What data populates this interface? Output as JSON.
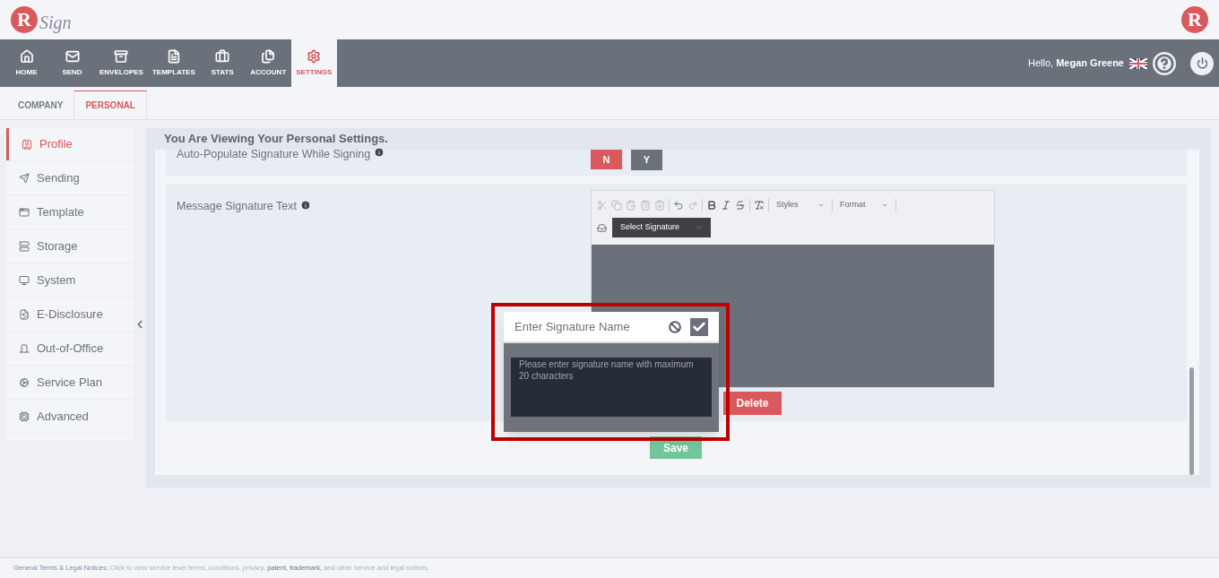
{
  "logo": {
    "letter": "R",
    "script": "Sign"
  },
  "corner_logo": {
    "letter": "R"
  },
  "nav": [
    {
      "label": "HOME",
      "selected": false
    },
    {
      "label": "SEND",
      "selected": false
    },
    {
      "label": "ENVELOPES",
      "selected": false
    },
    {
      "label": "TEMPLATES",
      "selected": false
    },
    {
      "label": "STATS",
      "selected": false
    },
    {
      "label": "ACCOUNT",
      "selected": false
    },
    {
      "label": "SETTINGS",
      "selected": true
    }
  ],
  "greeting": "Hello, **Megan Greene**",
  "subtabs": [
    {
      "label": "COMPANY",
      "selected": false
    },
    {
      "label": "PERSONAL",
      "selected": true
    }
  ],
  "sidebar": [
    {
      "label": "Profile",
      "selected": true
    },
    {
      "label": "Sending",
      "selected": false
    },
    {
      "label": "Template",
      "selected": false
    },
    {
      "label": "Storage",
      "selected": false
    },
    {
      "label": "System",
      "selected": false
    },
    {
      "label": "E-Disclosure",
      "selected": false
    },
    {
      "label": "Out-of-Office",
      "selected": false
    },
    {
      "label": "Service Plan",
      "selected": false
    },
    {
      "label": "Advanced",
      "selected": false
    }
  ],
  "heading": "You Are Viewing Your Personal Settings.",
  "auto_populate": {
    "label": "Auto-Populate Signature While Signing",
    "options": [
      {
        "label": "N",
        "selected": true
      },
      {
        "label": "Y",
        "selected": false
      }
    ]
  },
  "message_signature": {
    "label": "Message Signature Text",
    "styles": "Styles",
    "format": "Format",
    "select": "Select Signature",
    "delete": "Delete"
  },
  "save": "Save",
  "popup": {
    "title": "Enter Signature Name",
    "placeholder": "Please enter signature name with maximum 20 characters"
  },
  "footer": {
    "lead": "General Terms & Legal Notices:",
    "text_1": "Click to view service level terms, conditions, privacy,",
    "link_1": "patent,",
    "link_2": "trademark,",
    "text_2": "and other service and legal notices."
  }
}
